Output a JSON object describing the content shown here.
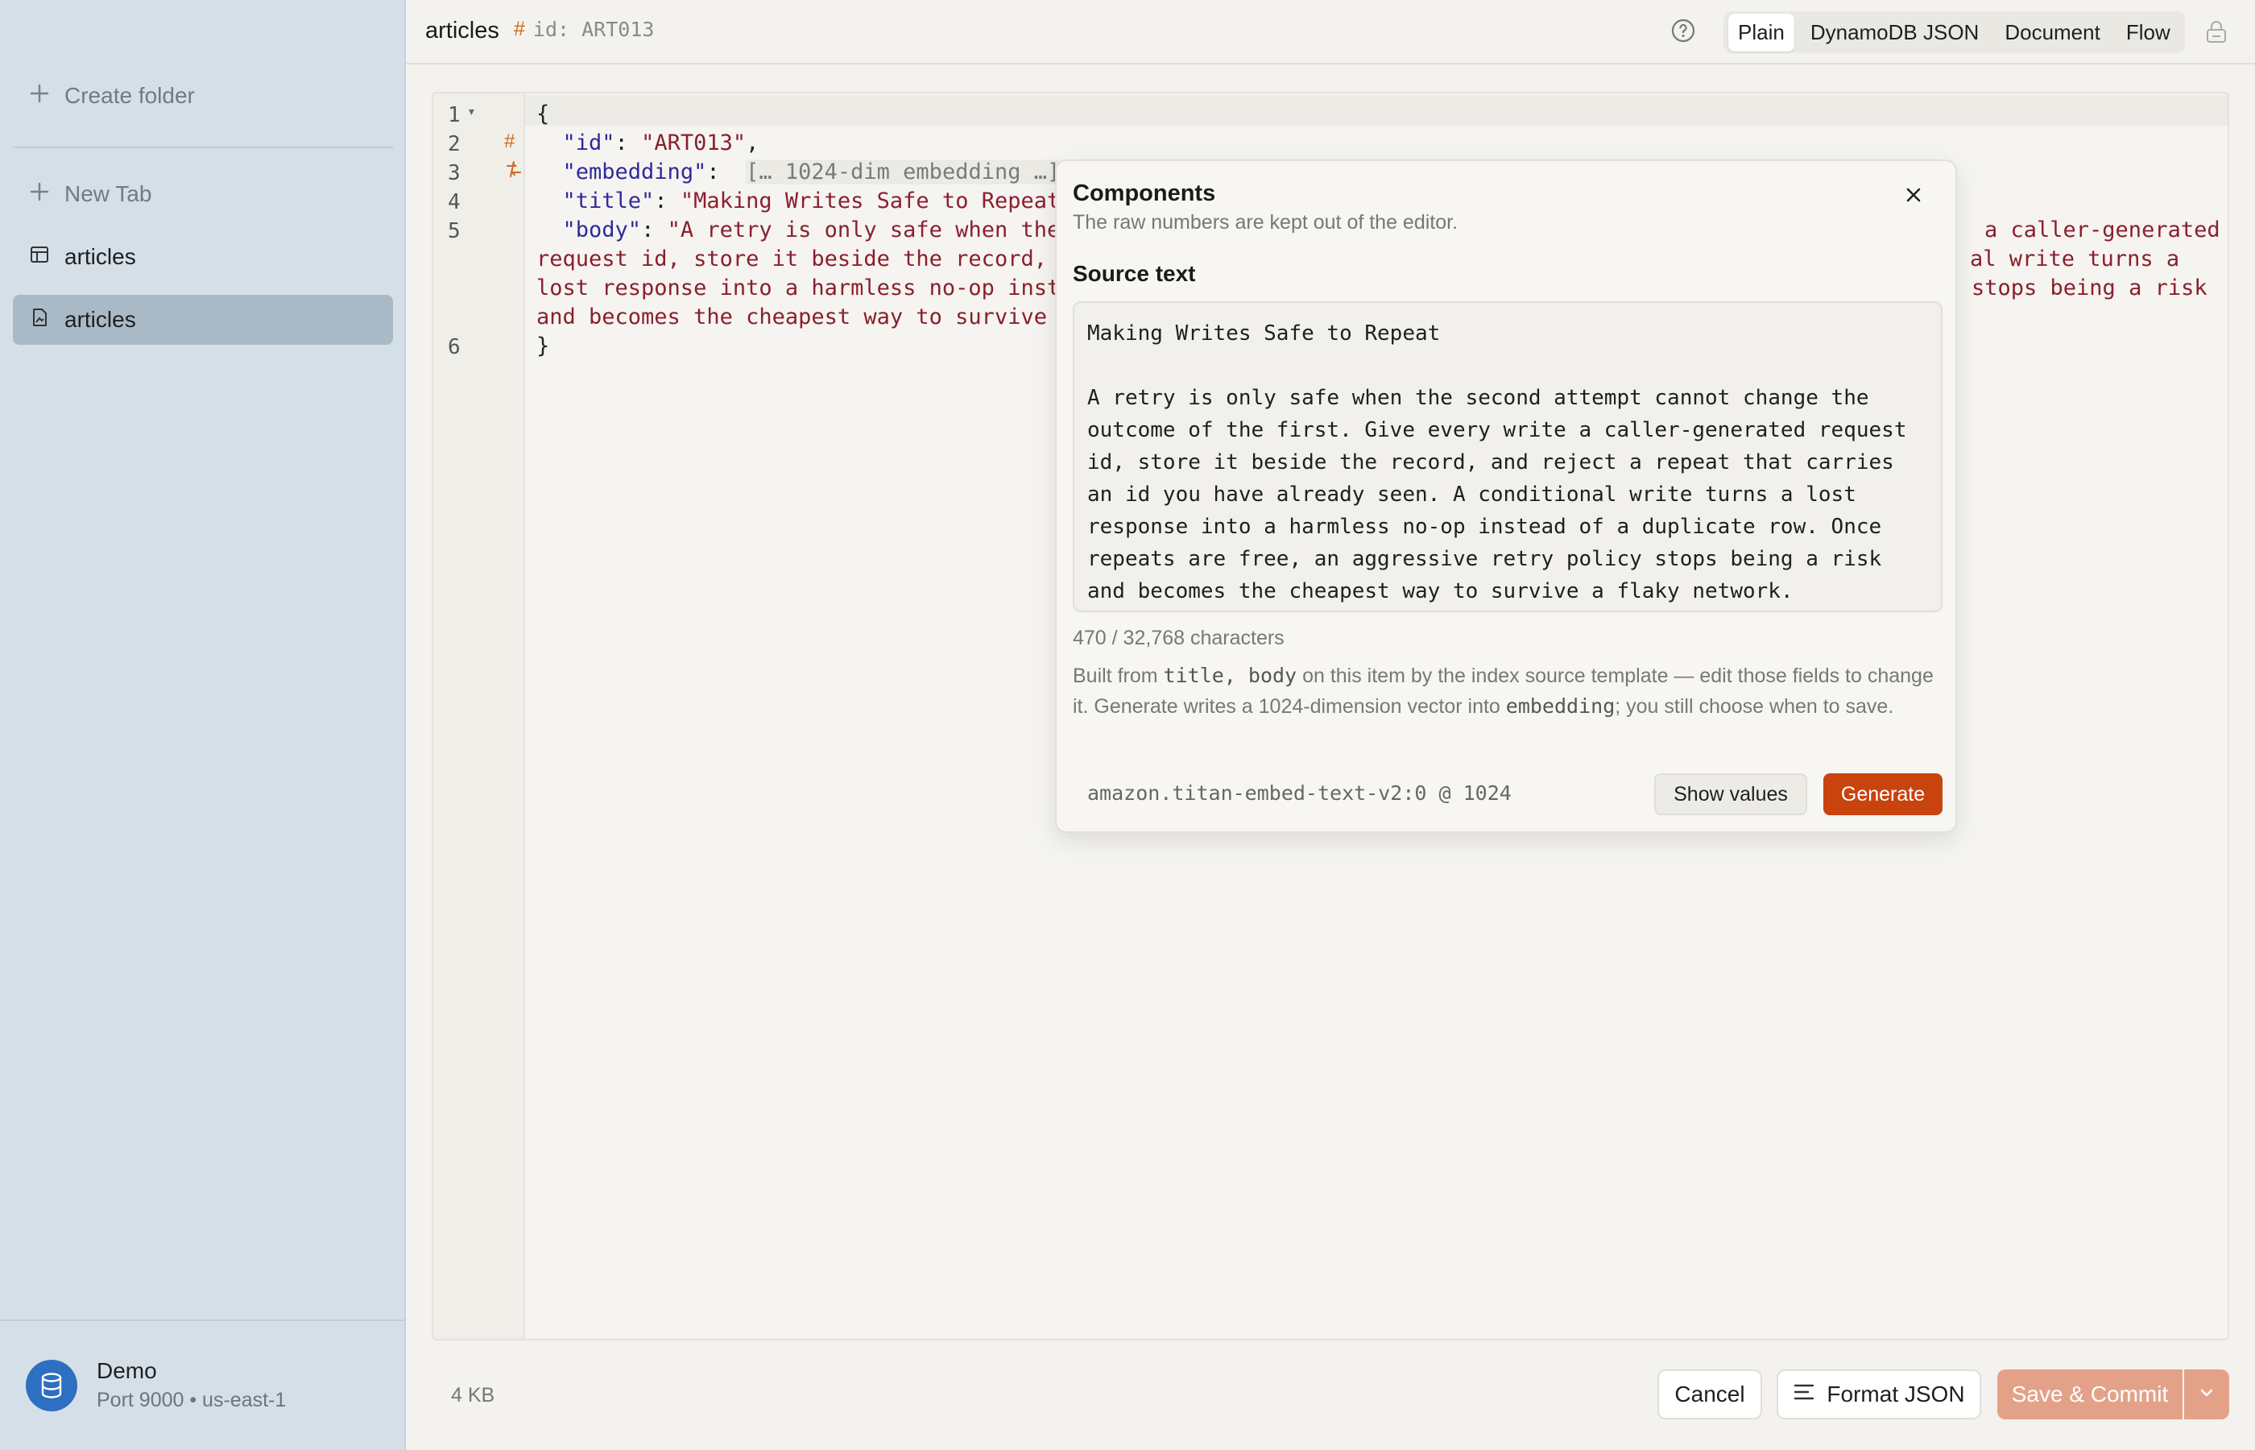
{
  "sidebar": {
    "create_folder": "Create folder",
    "new_tab": "New Tab",
    "items": [
      {
        "label": "articles",
        "icon": "table-icon"
      },
      {
        "label": "articles",
        "icon": "document-icon",
        "selected": true
      }
    ],
    "connection": {
      "name": "Demo",
      "detail": "Port 9000 • us-east-1",
      "icon": "database-icon"
    }
  },
  "header": {
    "table": "articles",
    "id_label": "id: ART013",
    "view_modes": [
      "Plain",
      "DynamoDB JSON",
      "Document",
      "Flow"
    ],
    "active_view": "Plain"
  },
  "editor": {
    "line_numbers": [
      "1",
      "2",
      "3",
      "4",
      "5",
      "6"
    ],
    "lines": {
      "open": "{",
      "id_key": "\"id\"",
      "id_val": "\"ART013\"",
      "emb_key": "\"embedding\"",
      "emb_fold": "[… 1024-dim embedding …]",
      "title_key": "\"title\"",
      "title_val": "\"Making Writes Safe to Repeat\"",
      "body_key": "\"body\"",
      "body_l1_a": "\"A retry is only safe when the s",
      "body_l1_b": "a caller-generated",
      "body_l2_a": "request id, store it beside the record, an",
      "body_l2_b": "al write turns a",
      "body_l3_a": "lost response into a harmless no-op instea",
      "body_l3_b": "stops being a risk",
      "body_l4_a": "and becomes the cheapest way to survive a",
      "close": "}"
    }
  },
  "popover": {
    "title": "Components",
    "subtitle": "The raw numbers are kept out of the editor.",
    "source_label": "Source text",
    "source_text": "Making Writes Safe to Repeat\n\nA retry is only safe when the second attempt cannot change the outcome of the first. Give every write a caller-generated request id, store it beside the record, and reject a repeat that carries an id you have already seen. A conditional write turns a lost response into a harmless no-op instead of a duplicate row. Once repeats are free, an aggressive retry policy stops being a risk and becomes the cheapest way to survive a flaky network.",
    "char_count": "470 / 32,768 characters",
    "note_prefix": "Built from",
    "note_fields": "title, body",
    "note_mid": "on this item by the index source template — edit those fields to change it. Generate writes a 1024-dimension vector into",
    "note_field2": "embedding",
    "note_suffix": "; you still choose when to save.",
    "model": "amazon.titan-embed-text-v2:0 @ 1024",
    "show_values": "Show values",
    "generate": "Generate"
  },
  "footer": {
    "size": "4 KB",
    "cancel": "Cancel",
    "format": "Format JSON",
    "save": "Save & Commit"
  },
  "colors": {
    "accent": "#c9430f",
    "sidebar": "#d5dfe7",
    "selected": "#a9bac6",
    "save_disabled": "#e3a288"
  }
}
